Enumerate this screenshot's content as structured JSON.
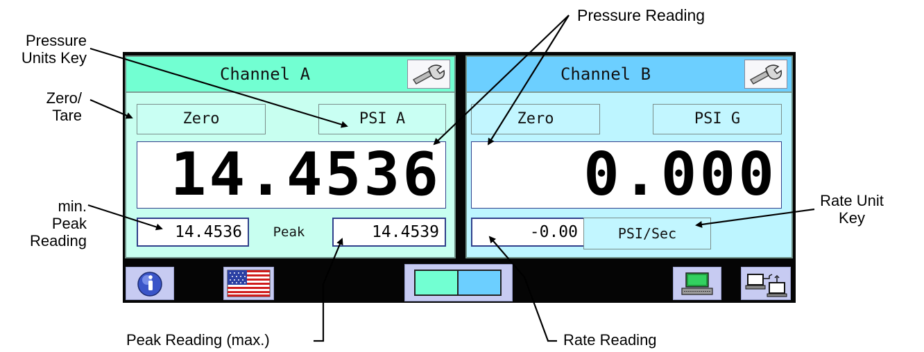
{
  "callouts": {
    "pressure_reading": "Pressure Reading",
    "pressure_units_key": [
      "Pressure",
      "Units Key"
    ],
    "zero_tare": [
      "Zero/",
      "Tare"
    ],
    "min_peak": [
      "min.",
      "Peak",
      "Reading"
    ],
    "rate_unit_key": [
      "Rate Unit",
      "Key"
    ],
    "peak_max": "Peak Reading (max.)",
    "rate_reading": "Rate Reading"
  },
  "channel_a": {
    "title": "Channel A",
    "zero_label": "Zero",
    "units": "PSI A",
    "reading": "14.4536",
    "min_peak": "14.4536",
    "peak_label": "Peak",
    "max_peak": "14.4539",
    "accent": "#72ffd2"
  },
  "channel_b": {
    "title": "Channel B",
    "zero_label": "Zero",
    "units": "PSI G",
    "reading": "0.000",
    "rate": "-0.00",
    "rate_unit": "PSI/Sec",
    "accent": "#6ccfff"
  },
  "toolbar": {
    "icons": [
      "info-icon",
      "us-flag-icon",
      "dual-channel-view-icon",
      "computer-icon",
      "network-icon"
    ]
  }
}
